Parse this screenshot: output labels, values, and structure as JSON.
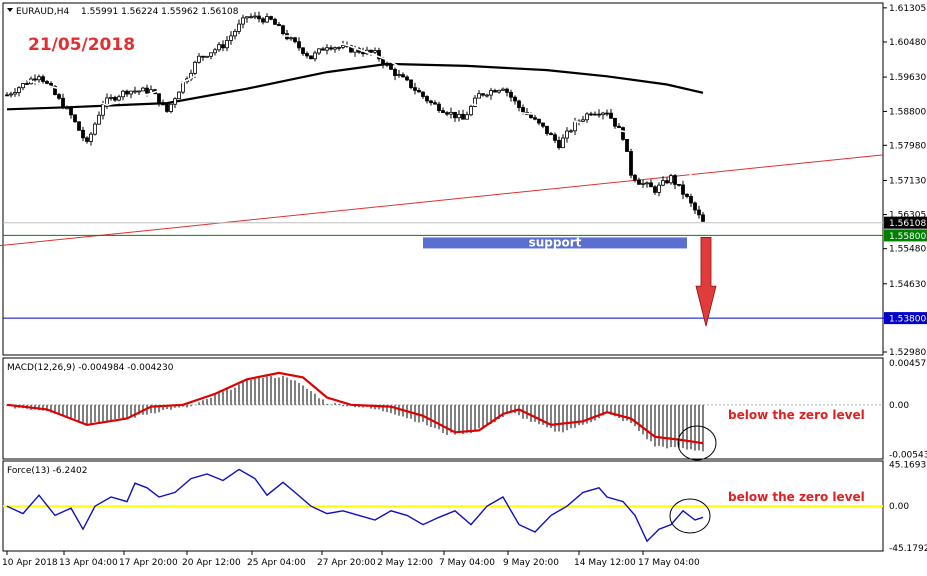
{
  "header": {
    "symbol": "EURAUD,H4",
    "ohlc": "1.55991 1.56224 1.55962 1.56108",
    "date": "21/05/2018"
  },
  "annotations": {
    "support": "support",
    "macd_note": "below the zero level",
    "force_note": "below the zero level"
  },
  "colors": {
    "date_text": "#e03030",
    "note_text": "#e02020",
    "support_box": "#5b6fd1",
    "support_line": "#008000",
    "target_line": "#0000cc",
    "trendline": "#e03030",
    "ma_slow": "#000000",
    "ma_fast": "#ffffff",
    "macd_signal": "#e00000",
    "force_line": "#1010c0",
    "force_zero": "#ffff00",
    "arrow": "#e03c3c",
    "tag_bg": "#0000cc",
    "tag_cur_bg": "#000000",
    "tag_green": "#008000"
  },
  "chart_data": [
    {
      "type": "candlestick",
      "name": "EURAUD,H4",
      "ylim": [
        1.5298,
        1.6135
      ],
      "price_ticks": [
        "1.61305",
        "1.60480",
        "1.59630",
        "1.58800",
        "1.57980",
        "1.57130",
        "1.56305",
        "1.55480",
        "1.54630",
        "1.53800",
        "1.52980"
      ],
      "current_price": "1.56108",
      "support_level": "1.55800",
      "target_level": "1.53800",
      "x_ticks": [
        "10 Apr 2018",
        "13 Apr 04:00",
        "17 Apr 20:00",
        "20 Apr 12:00",
        "25 Apr 04:00",
        "27 Apr 20:00",
        "2 May 12:00",
        "7 May 04:00",
        "9 May 20:00",
        "14 May 12:00",
        "17 May 04:00"
      ],
      "n_bars": 175,
      "close_anchors": [
        [
          0,
          1.592
        ],
        [
          8,
          1.597
        ],
        [
          16,
          1.587
        ],
        [
          20,
          1.58
        ],
        [
          24,
          1.59
        ],
        [
          30,
          1.593
        ],
        [
          36,
          1.593
        ],
        [
          40,
          1.588
        ],
        [
          44,
          1.595
        ],
        [
          48,
          1.601
        ],
        [
          54,
          1.604
        ],
        [
          60,
          1.611
        ],
        [
          66,
          1.61
        ],
        [
          70,
          1.606
        ],
        [
          76,
          1.601
        ],
        [
          80,
          1.604
        ],
        [
          86,
          1.603
        ],
        [
          92,
          1.602
        ],
        [
          96,
          1.598
        ],
        [
          100,
          1.595
        ],
        [
          106,
          1.59
        ],
        [
          110,
          1.588
        ],
        [
          114,
          1.586
        ],
        [
          118,
          1.592
        ],
        [
          124,
          1.594
        ],
        [
          128,
          1.589
        ],
        [
          134,
          1.584
        ],
        [
          138,
          1.58
        ],
        [
          142,
          1.585
        ],
        [
          146,
          1.588
        ],
        [
          150,
          1.588
        ],
        [
          154,
          1.582
        ],
        [
          156,
          1.573
        ],
        [
          158,
          1.571
        ],
        [
          162,
          1.569
        ],
        [
          166,
          1.572
        ],
        [
          170,
          1.567
        ],
        [
          174,
          1.5611
        ]
      ],
      "ma_slow": [
        [
          0,
          1.5885
        ],
        [
          15,
          1.589
        ],
        [
          40,
          1.59
        ],
        [
          60,
          1.5935
        ],
        [
          80,
          1.5975
        ],
        [
          95,
          1.5995
        ],
        [
          115,
          1.599
        ],
        [
          135,
          1.598
        ],
        [
          150,
          1.5965
        ],
        [
          165,
          1.5945
        ],
        [
          174,
          1.5925
        ]
      ],
      "ma_fast": [
        [
          5,
          1.5955
        ],
        [
          15,
          1.593
        ],
        [
          25,
          1.5895
        ],
        [
          35,
          1.592
        ],
        [
          45,
          1.5955
        ],
        [
          55,
          1.601
        ],
        [
          65,
          1.606
        ],
        [
          75,
          1.6065
        ],
        [
          85,
          1.604
        ],
        [
          95,
          1.6005
        ],
        [
          105,
          1.595
        ],
        [
          115,
          1.59
        ],
        [
          125,
          1.588
        ],
        [
          135,
          1.587
        ],
        [
          145,
          1.585
        ],
        [
          155,
          1.583
        ],
        [
          160,
          1.58
        ],
        [
          165,
          1.577
        ],
        [
          170,
          1.5735
        ],
        [
          174,
          1.57
        ]
      ],
      "trendline": [
        [
          -2,
          1.5555
        ],
        [
          219,
          1.5775
        ]
      ],
      "support_box_range": [
        104,
        170
      ],
      "arrow_bar": 175
    },
    {
      "type": "bar",
      "name": "MACD(12,26,9) -0.004984 -0.004230",
      "ylim": [
        -0.0056,
        0.0048
      ],
      "y_ticks": [
        "0.004573",
        "0.00",
        "-0.005439"
      ],
      "histogram": [
        [
          0,
          -0.0002
        ],
        [
          10,
          -0.0006
        ],
        [
          20,
          -0.002
        ],
        [
          30,
          -0.0015
        ],
        [
          40,
          -0.0005
        ],
        [
          46,
          -0.0002
        ],
        [
          56,
          0.0018
        ],
        [
          62,
          0.003
        ],
        [
          70,
          0.0031
        ],
        [
          76,
          0.0015
        ],
        [
          80,
          0.0002
        ],
        [
          88,
          -0.0002
        ],
        [
          96,
          -0.0008
        ],
        [
          104,
          -0.002
        ],
        [
          110,
          -0.0032
        ],
        [
          116,
          -0.003
        ],
        [
          122,
          -0.0018
        ],
        [
          126,
          -0.0008
        ],
        [
          132,
          -0.002
        ],
        [
          138,
          -0.003
        ],
        [
          144,
          -0.0022
        ],
        [
          150,
          -0.001
        ],
        [
          156,
          -0.002
        ],
        [
          162,
          -0.0045
        ],
        [
          168,
          -0.0048
        ],
        [
          174,
          -0.005
        ]
      ],
      "signal": [
        [
          0,
          0.0
        ],
        [
          10,
          -0.0005
        ],
        [
          20,
          -0.0022
        ],
        [
          30,
          -0.0015
        ],
        [
          36,
          -0.0002
        ],
        [
          44,
          0.0
        ],
        [
          52,
          0.0012
        ],
        [
          60,
          0.0028
        ],
        [
          68,
          0.0035
        ],
        [
          74,
          0.003
        ],
        [
          80,
          0.0008
        ],
        [
          86,
          0.0
        ],
        [
          96,
          -0.0002
        ],
        [
          104,
          -0.0012
        ],
        [
          112,
          -0.003
        ],
        [
          118,
          -0.0028
        ],
        [
          124,
          -0.001
        ],
        [
          128,
          -0.0005
        ],
        [
          136,
          -0.0022
        ],
        [
          144,
          -0.0018
        ],
        [
          150,
          -0.0008
        ],
        [
          156,
          -0.0015
        ],
        [
          162,
          -0.0035
        ],
        [
          168,
          -0.0038
        ],
        [
          174,
          -0.0042
        ]
      ]
    },
    {
      "type": "line",
      "name": "Force(13) -6.2402",
      "ylim": [
        -46.5,
        47
      ],
      "y_ticks": [
        "45.1693",
        "0.00",
        "-45.1792"
      ],
      "values": [
        [
          0,
          0
        ],
        [
          4,
          -8
        ],
        [
          8,
          12
        ],
        [
          12,
          -10
        ],
        [
          16,
          -2
        ],
        [
          19,
          -25
        ],
        [
          22,
          0
        ],
        [
          26,
          10
        ],
        [
          30,
          5
        ],
        [
          32,
          25
        ],
        [
          35,
          20
        ],
        [
          38,
          10
        ],
        [
          42,
          15
        ],
        [
          46,
          30
        ],
        [
          50,
          35
        ],
        [
          54,
          28
        ],
        [
          58,
          40
        ],
        [
          62,
          30
        ],
        [
          65,
          12
        ],
        [
          69,
          26
        ],
        [
          72,
          15
        ],
        [
          76,
          0
        ],
        [
          80,
          -8
        ],
        [
          84,
          -5
        ],
        [
          88,
          -10
        ],
        [
          92,
          -15
        ],
        [
          96,
          -5
        ],
        [
          100,
          -10
        ],
        [
          104,
          -20
        ],
        [
          108,
          -12
        ],
        [
          112,
          -5
        ],
        [
          116,
          -20
        ],
        [
          120,
          0
        ],
        [
          124,
          10
        ],
        [
          128,
          -20
        ],
        [
          132,
          -28
        ],
        [
          136,
          -10
        ],
        [
          140,
          0
        ],
        [
          144,
          15
        ],
        [
          148,
          20
        ],
        [
          150,
          10
        ],
        [
          154,
          5
        ],
        [
          157,
          -10
        ],
        [
          160,
          -38
        ],
        [
          163,
          -25
        ],
        [
          166,
          -20
        ],
        [
          169,
          -5
        ],
        [
          172,
          -15
        ],
        [
          174,
          -12
        ]
      ]
    }
  ]
}
